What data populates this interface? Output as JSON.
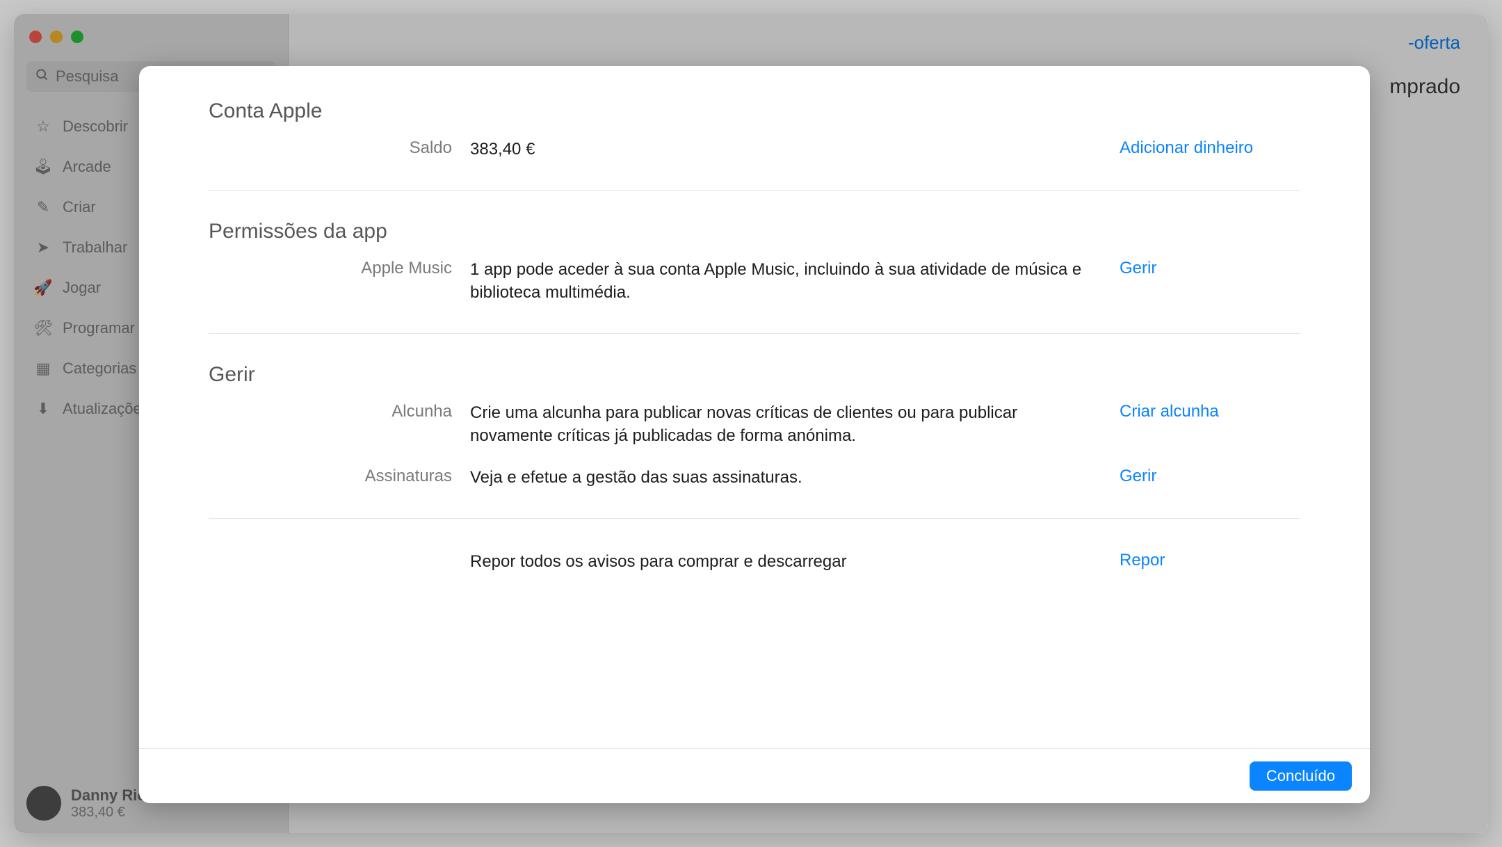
{
  "sidebar": {
    "search_placeholder": "Pesquisa",
    "items": [
      {
        "icon": "star",
        "label": "Descobrir"
      },
      {
        "icon": "arcade",
        "label": "Arcade"
      },
      {
        "icon": "brush",
        "label": "Criar"
      },
      {
        "icon": "send",
        "label": "Trabalhar"
      },
      {
        "icon": "rocket",
        "label": "Jogar"
      },
      {
        "icon": "hammer",
        "label": "Programar"
      },
      {
        "icon": "grid",
        "label": "Categorias"
      },
      {
        "icon": "download",
        "label": "Atualizações"
      }
    ],
    "user": {
      "name": "Danny Rico",
      "balance": "383,40 €"
    }
  },
  "background": {
    "top_link": "-oferta",
    "status": "mprado"
  },
  "modal": {
    "sections": [
      {
        "title": "Conta Apple",
        "rows": [
          {
            "label": "Saldo",
            "value": "383,40 €",
            "action": "Adicionar dinheiro"
          }
        ]
      },
      {
        "title": "Permissões da app",
        "rows": [
          {
            "label": "Apple Music",
            "value": "1 app pode aceder à sua conta Apple Music, incluindo à sua atividade de música e biblioteca multimédia.",
            "action": "Gerir"
          }
        ]
      },
      {
        "title": "Gerir",
        "rows": [
          {
            "label": "Alcunha",
            "value": "Crie uma alcunha para publicar novas críticas de clientes ou para publicar novamente críticas já publicadas de forma anónima.",
            "action": "Criar alcunha"
          },
          {
            "label": "Assinaturas",
            "value": "Veja e efetue a gestão das suas assinaturas.",
            "action": "Gerir"
          }
        ]
      },
      {
        "title": "",
        "rows": [
          {
            "label": "",
            "value": "Repor todos os avisos para comprar e descarregar",
            "action": "Repor"
          }
        ]
      }
    ],
    "footer": {
      "done_label": "Concluído"
    }
  }
}
